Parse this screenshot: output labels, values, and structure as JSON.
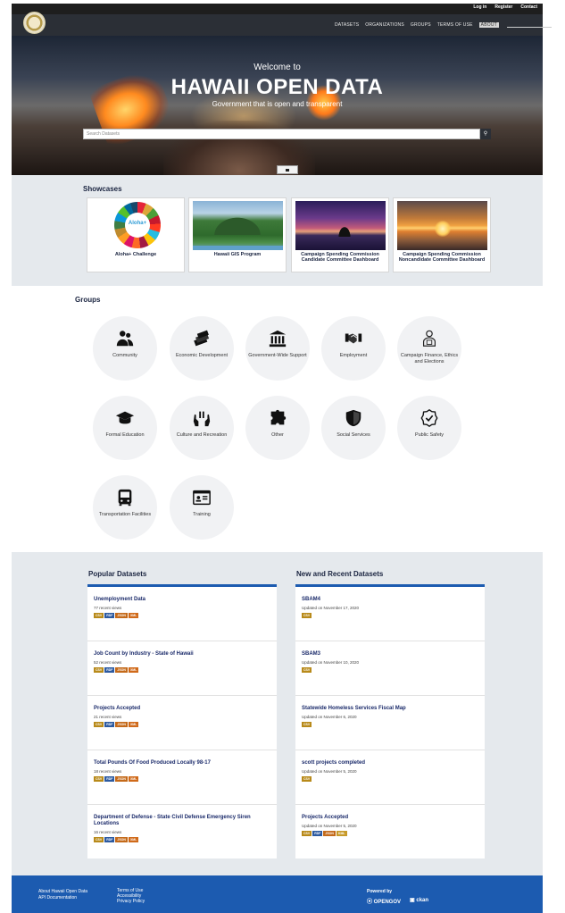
{
  "account": {
    "login": "Log in",
    "register": "Register",
    "contact": "Contact"
  },
  "nav": {
    "items": [
      "DATASETS",
      "ORGANIZATIONS",
      "GROUPS",
      "TERMS OF USE",
      "ABOUT"
    ],
    "active": "ABOUT",
    "search_icon": "search-icon"
  },
  "hero": {
    "welcome": "Welcome to",
    "title": "HAWAII OPEN DATA",
    "subtitle": "Government that is open and transparent",
    "search_placeholder": "Search Datasets",
    "search_button_icon": "search-icon"
  },
  "showcases": {
    "title": "Showcases",
    "items": [
      {
        "label": "Aloha+ Challenge",
        "logo_text": "Aloha+"
      },
      {
        "label": "Hawaii GIS Program"
      },
      {
        "label": "Campaign Spending Commission Candidate Committee Dashboard"
      },
      {
        "label": "Campaign Spending Commission Noncandidate Committee Dashboard"
      }
    ]
  },
  "groups": {
    "title": "Groups",
    "items": [
      {
        "label": "Community",
        "icon": "community-icon"
      },
      {
        "label": "Economic Development",
        "icon": "money-icon"
      },
      {
        "label": "Government-Wide Support",
        "icon": "government-building-icon"
      },
      {
        "label": "Employment",
        "icon": "handshake-icon"
      },
      {
        "label": "Campaign Finance, Ethics and Elections",
        "icon": "campaign-finance-icon"
      },
      {
        "label": "Formal Education",
        "icon": "graduation-cap-icon"
      },
      {
        "label": "Culture and Recreation",
        "icon": "hands-icon"
      },
      {
        "label": "Other",
        "icon": "puzzle-icon"
      },
      {
        "label": "Social Services",
        "icon": "shield-icon"
      },
      {
        "label": "Public Safety",
        "icon": "badge-check-icon"
      },
      {
        "label": "Transportation Facilities",
        "icon": "bus-icon"
      },
      {
        "label": "Training",
        "icon": "id-card-icon"
      }
    ]
  },
  "popular": {
    "title": "Popular Datasets",
    "items": [
      {
        "title": "Unemployment Data",
        "meta": "77 recent views",
        "formats": [
          "CSV",
          "RDF",
          "JSON",
          "XML"
        ]
      },
      {
        "title": "Job Count by Industry - State of Hawaii",
        "meta": "52 recent views",
        "formats": [
          "CSV",
          "RDF",
          "JSON",
          "XML"
        ]
      },
      {
        "title": "Projects Accepted",
        "meta": "21 recent views",
        "formats": [
          "CSV",
          "RDF",
          "JSON",
          "XML"
        ]
      },
      {
        "title": "Total Pounds Of Food Produced Locally 98-17",
        "meta": "18 recent views",
        "formats": [
          "CSV",
          "RDF",
          "JSON",
          "XML"
        ]
      },
      {
        "title": "Department of Defense - State Civil Defense Emergency Siren Locations",
        "meta": "16 recent views",
        "formats": [
          "CSV",
          "RDF",
          "JSON",
          "XML"
        ]
      }
    ]
  },
  "recent": {
    "title": "New and Recent Datasets",
    "items": [
      {
        "title": "SBAM4",
        "meta": "Updated on November 17, 2020",
        "formats": [
          "CSV"
        ]
      },
      {
        "title": "SBAM3",
        "meta": "Updated on November 10, 2020",
        "formats": [
          "CSV"
        ]
      },
      {
        "title": "Statewide Homeless Services Fiscal Map",
        "meta": "Updated on November 6, 2020",
        "formats": [
          "CSV"
        ]
      },
      {
        "title": "scott projects completed",
        "meta": "Updated on November 5, 2020",
        "formats": [
          "CSV"
        ]
      },
      {
        "title": "Projects Accepted",
        "meta": "Updated on November 5, 2020",
        "formats": [
          "CSV",
          "RDF",
          "JSON",
          "KML"
        ]
      }
    ]
  },
  "footer": {
    "col1": [
      "About Hawaii Open Data",
      "API Documentation"
    ],
    "col2": [
      "Terms of Use",
      "Accessibility",
      "Privacy Policy"
    ],
    "powered_by": "Powered by",
    "logo1": "OPENGOV",
    "logo2": "ckan"
  },
  "colors": {
    "brand_blue": "#1c5bb0",
    "navbar": "#2b2f36",
    "section_bg": "#e5e9ed"
  }
}
